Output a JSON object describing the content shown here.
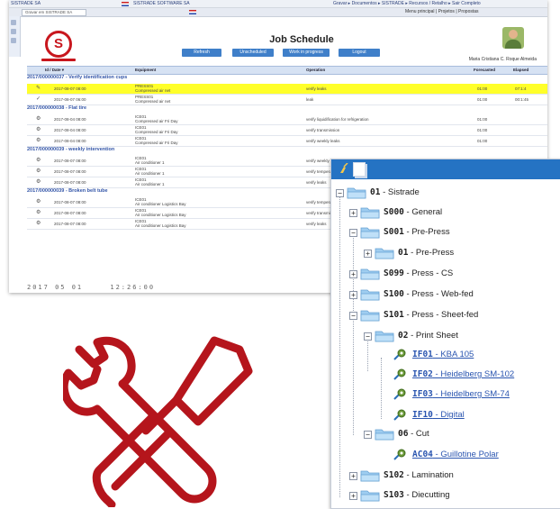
{
  "browser": {
    "tab1": "SISTRADE SA",
    "tab2": "SISTRADE SOFTWARE SA",
    "tab3": "Gravar em SISTRADE SA",
    "bar1_right": "Gravar ▸ Documentos ▸ SISTRADE ▸ Recursos / Retalho ▸ Sair Completo",
    "bar2_right": "Menu principal  |  Projetos  |  Propostas"
  },
  "header": {
    "title": "Job Schedule",
    "buttons": [
      "Refresh",
      "Unscheduled",
      "Work in progress",
      "Logout"
    ],
    "user_name": "Maria Cristiana C. Roque Almeida"
  },
  "table": {
    "columns": [
      "Id / Date ▾",
      "Equipment",
      "Operation",
      "Forecasted",
      "Elapsed"
    ],
    "groups": [
      {
        "title": "2017/000000037 - Verify identification cups",
        "rows": [
          {
            "icon": "✎",
            "date": "2017-08-07 08:00",
            "equip": "PRESS01",
            "equip2": "Compressed air net",
            "op": "verify leaks",
            "fc": "01:00",
            "el": "07:1:4",
            "hl": true
          },
          {
            "icon": "✓",
            "date": "2017-08-07 06:00",
            "equip": "PRESS01",
            "equip2": "Compressed air net",
            "op": "leak",
            "fc": "01:00",
            "el": "00:1:45",
            "hl": false
          }
        ]
      },
      {
        "title": "2017/000000038 - Flat tire",
        "rows": [
          {
            "icon": "⚙",
            "date": "2017-08-04 08:00",
            "equip": "ICE01",
            "equip2": "Compressed air Fri Day",
            "op": "verify liquidification for refrigeration",
            "fc": "01:00",
            "el": "",
            "hl": false
          },
          {
            "icon": "⚙",
            "date": "2017-08-04 08:00",
            "equip": "ICE01",
            "equip2": "Compressed air Fri Day",
            "op": "verify transmission",
            "fc": "01:00",
            "el": "",
            "hl": false
          },
          {
            "icon": "⚙",
            "date": "2017-08-04 08:00",
            "equip": "ICE01",
            "equip2": "Compressed air Fri Day",
            "op": "verify weekly leaks",
            "fc": "01:00",
            "el": "",
            "hl": false
          }
        ]
      },
      {
        "title": "2017/000000039 - weekly intervention",
        "rows": [
          {
            "icon": "⚙",
            "date": "2017-08-07 08:00",
            "equip": "ICE01",
            "equip2": "Air conditioner 1",
            "op": "verify weekly leaks",
            "fc": "",
            "el": "",
            "hl": false
          },
          {
            "icon": "⚙",
            "date": "2017-08-07 08:00",
            "equip": "ICE01",
            "equip2": "Air conditioner 1",
            "op": "verify temperature levels",
            "fc": "",
            "el": "",
            "hl": false
          },
          {
            "icon": "⚙",
            "date": "2017-08-07 08:00",
            "equip": "ICE01",
            "equip2": "Air conditioner 1",
            "op": "verify leaks",
            "fc": "",
            "el": "",
            "hl": false
          }
        ]
      },
      {
        "title": "2017/000000039 - Broken belt tube",
        "rows": [
          {
            "icon": "⚙",
            "date": "2017-08-07 08:00",
            "equip": "ICE01",
            "equip2": "Air conditioner Logistics Bay",
            "op": "verify temperature levels",
            "fc": "",
            "el": "",
            "hl": false
          },
          {
            "icon": "⚙",
            "date": "2017-08-07 08:00",
            "equip": "ICE01",
            "equip2": "Air conditioner Logistics Bay",
            "op": "verify transmission",
            "fc": "",
            "el": "",
            "hl": false
          },
          {
            "icon": "⚙",
            "date": "2017-08-07 08:00",
            "equip": "ICE01",
            "equip2": "Air conditioner Logistics Bay",
            "op": "verify leaks",
            "fc": "",
            "el": "",
            "hl": false
          }
        ]
      }
    ]
  },
  "footer": {
    "date": "2017 05 01",
    "time": "12:26:00"
  },
  "tree": {
    "nodes": [
      {
        "code": "01",
        "name": " - Sistrade"
      },
      {
        "code": "S000",
        "name": " - General"
      },
      {
        "code": "S001",
        "name": " - Pre-Press"
      },
      {
        "code": "01",
        "name": " - Pre-Press"
      },
      {
        "code": "S099",
        "name": " - Press - CS"
      },
      {
        "code": "S100",
        "name": " - Press - Web-fed"
      },
      {
        "code": "S101",
        "name": " - Press - Sheet-fed"
      },
      {
        "code": "02",
        "name": " - Print Sheet"
      },
      {
        "code": "IF01",
        "name": " - KBA 105"
      },
      {
        "code": "IF02",
        "name": " - Heidelberg SM-102"
      },
      {
        "code": "IF03",
        "name": " - Heidelberg SM-74"
      },
      {
        "code": "IF10",
        "name": " - Digital"
      },
      {
        "code": "06",
        "name": " - Cut"
      },
      {
        "code": "AC04",
        "name": " - Guillotine Polar"
      },
      {
        "code": "S102",
        "name": " - Lamination"
      },
      {
        "code": "S103",
        "name": " - Diecutting"
      }
    ]
  },
  "colors": {
    "brand_red": "#c8161d",
    "tree_bar": "#2573c3",
    "highlight": "#ffff2a",
    "button_blue": "#3f7fc9"
  }
}
